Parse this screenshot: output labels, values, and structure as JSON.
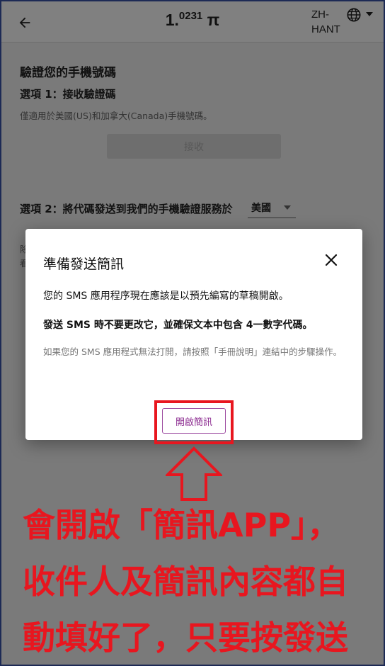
{
  "header": {
    "balance_whole": "1.",
    "balance_decimals": "0231",
    "currency_symbol": "π",
    "language_code": "ZH-HANT"
  },
  "page": {
    "verify_title": "驗證您的手機號碼",
    "option1": {
      "title": "選項 1：接收驗證碼",
      "description": "僅適用於美國(US)和加拿大(Canada)手機號碼。",
      "receive_label": "接收"
    },
    "option2": {
      "title": "選項 2：將代碼發送到我們的手機驗證服務於",
      "country_value": "美國"
    },
    "obscured_text_1": "除",
    "obscured_text_2": "看"
  },
  "dialog": {
    "title": "準備發送簡訊",
    "line1": "您的 SMS 應用程序現在應該是以預先編寫的草稿開啟。",
    "line2": "發送 SMS 時不要更改它，並確保文本中包含 4一數字代碼。",
    "note": "如果您的 SMS 應用程式無法打開，請按照「手冊說明」連結中的步驟操作。",
    "open_sms_label": "開啟簡訊"
  },
  "annotation": {
    "line1": "會開啟「簡訊APP」，",
    "line2": "收件人及簡訊內容都自",
    "line3": "動填好了，只要按發送"
  },
  "colors": {
    "accent_purple": "#8e2f92",
    "annotation_red": "#e8161f",
    "overlay_gray": "#7a7a7a"
  },
  "icons": {
    "back": "back-arrow-icon",
    "globe": "globe-icon",
    "caret": "chevron-down-icon",
    "close": "close-icon",
    "annotation_arrow": "up-arrow-icon"
  }
}
